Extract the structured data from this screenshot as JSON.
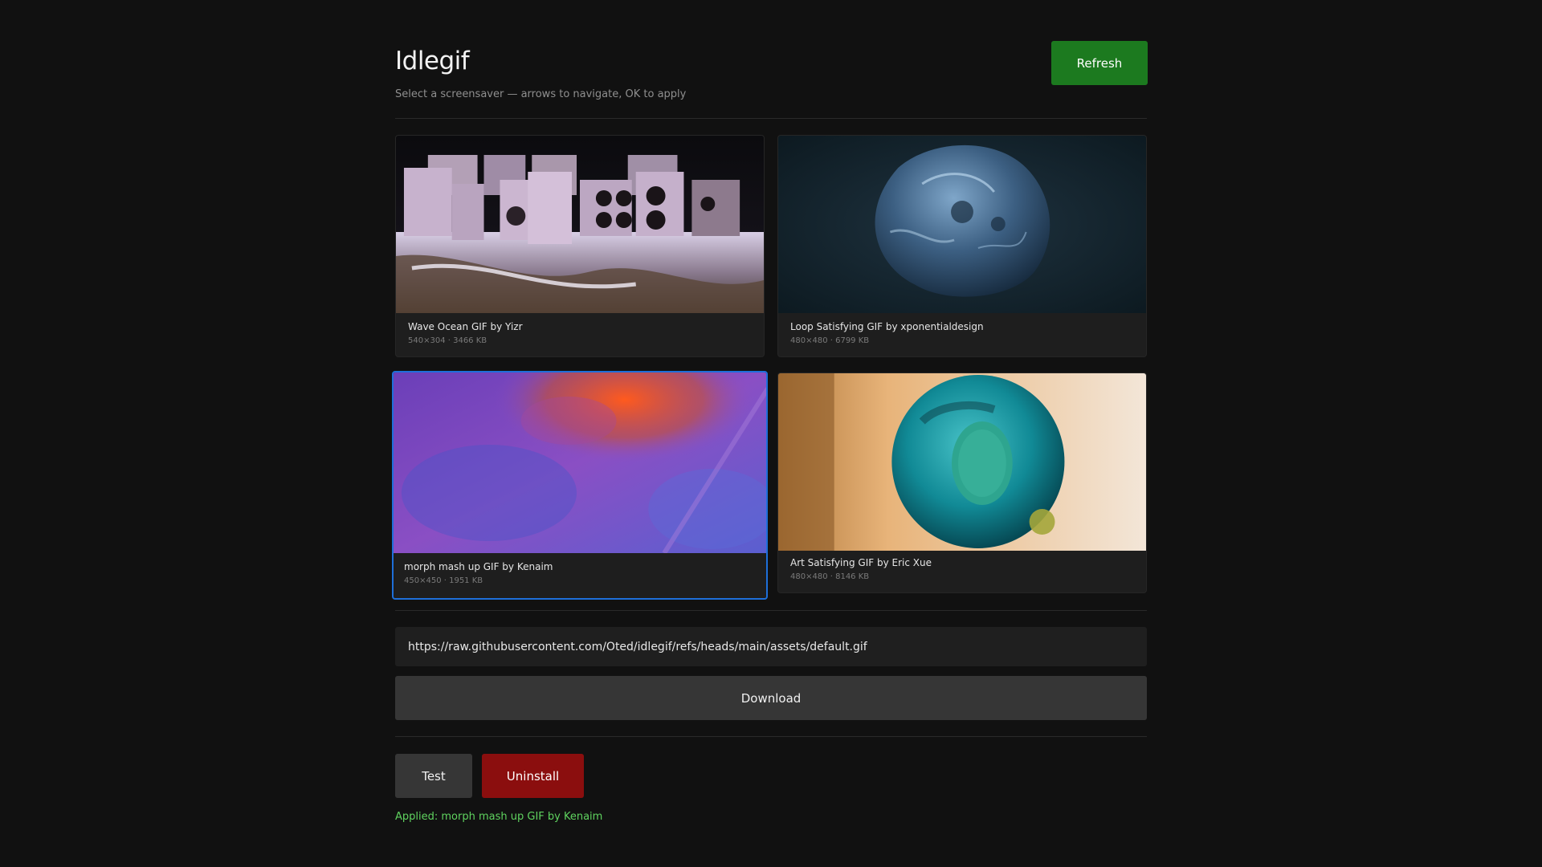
{
  "header": {
    "title": "Idlegif",
    "subtitle": "Select a screensaver — arrows to navigate, OK to apply",
    "refresh_label": "Refresh"
  },
  "gifs": [
    {
      "title": "Wave Ocean GIF by Yizr",
      "meta": "540×304 · 3466 KB",
      "selected": false
    },
    {
      "title": "Loop Satisfying GIF by xponentialdesign",
      "meta": "480×480 · 6799 KB",
      "selected": false
    },
    {
      "title": "morph mash up GIF by Kenaim",
      "meta": "450×450 · 1951 KB",
      "selected": true
    },
    {
      "title": "Art Satisfying GIF by Eric Xue",
      "meta": "480×480 · 8146 KB",
      "selected": false
    }
  ],
  "download": {
    "url_value": "https://raw.githubusercontent.com/Oted/idlegif/refs/heads/main/assets/default.gif",
    "button_label": "Download"
  },
  "actions": {
    "test_label": "Test",
    "uninstall_label": "Uninstall"
  },
  "status": {
    "text": "Applied: morph mash up GIF by Kenaim"
  },
  "colors": {
    "background": "#111111",
    "refresh": "#1c7a1f",
    "uninstall": "#8b0e0e",
    "selected_border": "#1e6fd9",
    "status": "#5fd35f"
  }
}
